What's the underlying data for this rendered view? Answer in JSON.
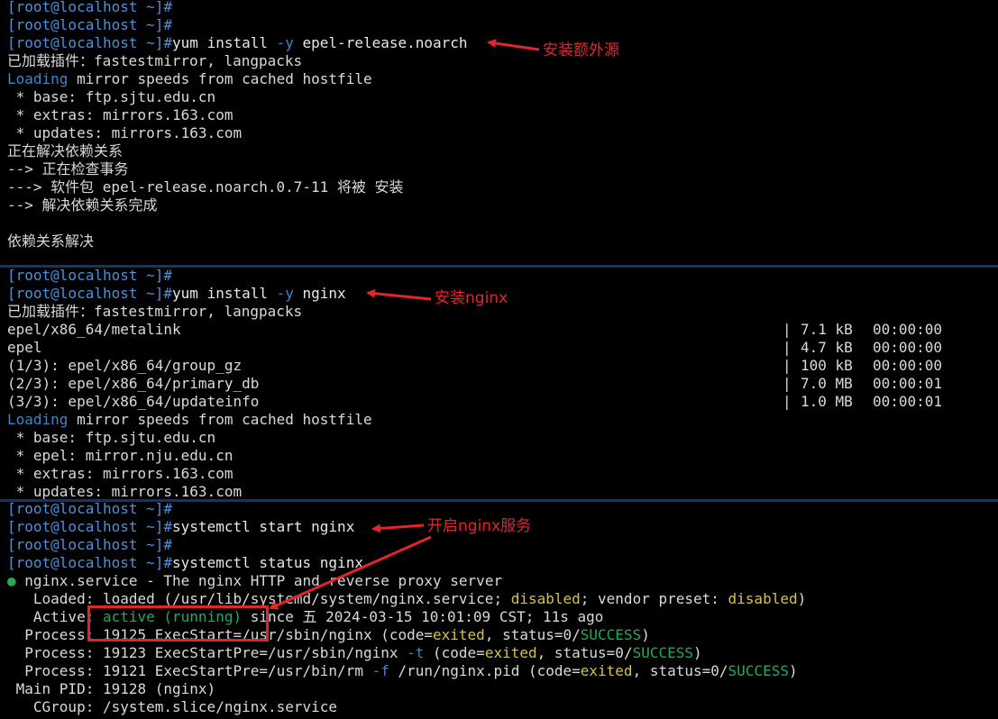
{
  "panel1": {
    "lines": [
      "[root@localhost ~]#",
      "[root@localhost ~]#",
      "[root@localhost ~]#yum install -y epel-release.noarch",
      "已加载插件：fastestmirror, langpacks",
      "Loading mirror speeds from cached hostfile",
      " * base: ftp.sjtu.edu.cn",
      " * extras: mirrors.163.com",
      " * updates: mirrors.163.com",
      "正在解决依赖关系",
      "--> 正在检查事务",
      "---> 软件包 epel-release.noarch.0.7-11 将被 安装",
      "--> 解决依赖关系完成",
      "",
      "依赖关系解决"
    ],
    "prompt": "[root@localhost ~]#",
    "cmd_parts": [
      "yum install ",
      "-y",
      " epel-release.noarch"
    ],
    "loading_word": "Loading",
    "loading_rest": " mirror speeds from cached hostfile"
  },
  "panel2": {
    "prompt": "[root@localhost ~]#",
    "cmd_parts": [
      "yum install ",
      "-y",
      " nginx"
    ],
    "plugins": "已加载插件：fastestmirror, langpacks",
    "downloads": [
      {
        "name": "epel/x86_64/metalink",
        "bar": "|",
        "size": "7.1 kB",
        "time": "00:00:00"
      },
      {
        "name": "epel",
        "bar": "|",
        "size": "4.7 kB",
        "time": "00:00:00"
      },
      {
        "name": "(1/3): epel/x86_64/group_gz",
        "bar": "|",
        "size": "100 kB",
        "time": "00:00:00"
      },
      {
        "name": "(2/3): epel/x86_64/primary_db",
        "bar": "|",
        "size": "7.0 MB",
        "time": "00:00:01"
      },
      {
        "name": "(3/3): epel/x86_64/updateinfo",
        "bar": "|",
        "size": "1.0 MB",
        "time": "00:00:01"
      }
    ],
    "loading_word": "Loading",
    "loading_rest": " mirror speeds from cached hostfile",
    "mirrors": [
      " * base: ftp.sjtu.edu.cn",
      " * epel: mirror.nju.edu.cn",
      " * extras: mirrors.163.com",
      " * updates: mirrors.163.com"
    ]
  },
  "panel3": {
    "prompt": "[root@localhost ~]#",
    "cmd_start": "systemctl start nginx",
    "cmd_status": "systemctl status nginx",
    "service_dot": "●",
    "service_line": " nginx.service - The nginx HTTP and reverse proxy server",
    "loaded": {
      "a": "   Loaded: loaded (/usr/lib/systemd/system/nginx.service; ",
      "b": "disabled",
      "c": "; vendor preset: ",
      "d": "disabled",
      "e": ")"
    },
    "active": {
      "a": "   Active: ",
      "b": "active (running)",
      "c": " since 五 2024-03-15 10:01:09 CST; 11s ago"
    },
    "process1": {
      "a": "  Process: 19125 ExecStart=/usr/sbin/nginx (code=",
      "b": "exited",
      "c": ", status=0/",
      "d": "SUCCESS",
      "e": ")"
    },
    "process2": {
      "a": "  Process: 19123 ExecStartPre=/usr/sbin/nginx ",
      "b": "-t",
      "c": " (code=",
      "d": "exited",
      "e": ", status=0/",
      "f": "SUCCESS",
      "g": ")"
    },
    "process3": {
      "a": "  Process: 19121 ExecStartPre=/usr/bin/rm ",
      "b": "-f",
      "c": " /run/nginx.pid (code=",
      "d": "exited",
      "e": ", status=0/",
      "f": "SUCCESS",
      "g": ")"
    },
    "mainpid": " Main PID: 19128 (nginx)",
    "cgroup": "   CGroup: /system.slice/nginx.service"
  },
  "annotations": {
    "note1": "安装额外源",
    "note2": "安装nginx",
    "note3": "开启nginx服务"
  },
  "colors": {
    "prompt": "#4f8fd8",
    "green": "#1fae55",
    "yellow": "#d6c341",
    "annotation": "#e5232b"
  }
}
